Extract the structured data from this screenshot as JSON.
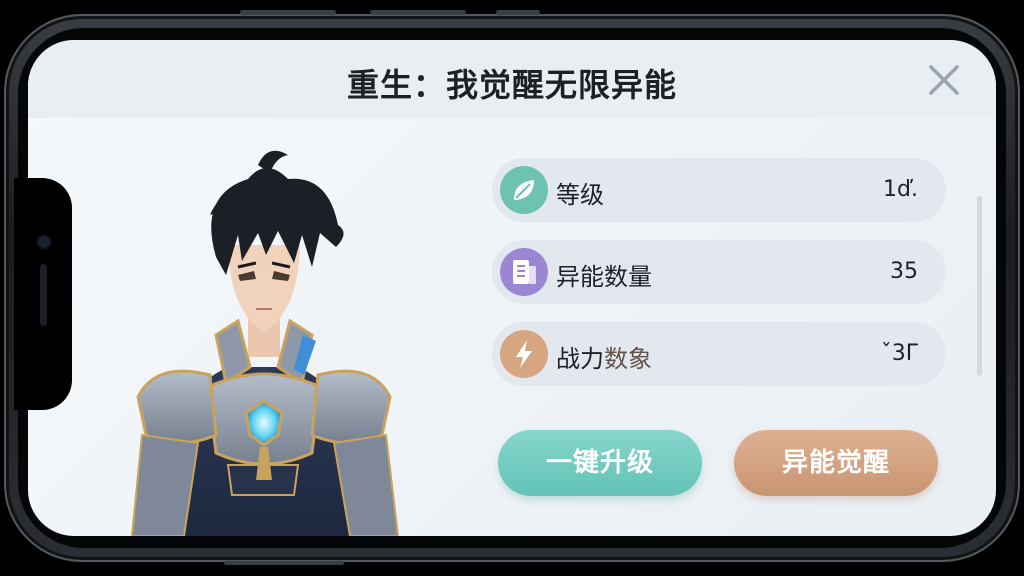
{
  "header": {
    "title": "重生：我觉醒无限异能",
    "close_icon": "close-icon"
  },
  "stats": [
    {
      "label": "等级",
      "value": "1ď.",
      "icon": "leaf-icon",
      "color": "#6ec2b2"
    },
    {
      "label": "异能数量",
      "value": "35",
      "icon": "book-icon",
      "color": "#9b86d4"
    },
    {
      "label": "战力",
      "label_suffix": "数象",
      "value": "ˇ3Γ",
      "icon": "lightning-icon",
      "color": "#d5a67f"
    }
  ],
  "buttons": {
    "upgrade": {
      "label": "一键升级",
      "color": "#6bc6ba"
    },
    "awaken": {
      "label": "异能觉醒",
      "color": "#cf9c7a"
    }
  }
}
